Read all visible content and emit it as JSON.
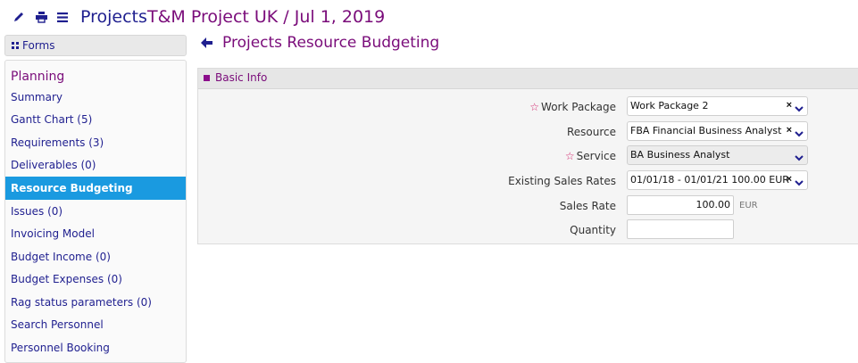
{
  "header": {
    "title_main": "Projects",
    "title_sub": "T&M Project UK / Jul 1, 2019",
    "icons": [
      "pencil-icon",
      "print-icon",
      "menu-icon"
    ]
  },
  "sidebar": {
    "forms_label": "Forms",
    "section_heading": "Planning",
    "items": [
      {
        "label": "Summary",
        "active": false
      },
      {
        "label": "Gantt Chart (5)",
        "active": false
      },
      {
        "label": "Requirements (3)",
        "active": false
      },
      {
        "label": "Deliverables (0)",
        "active": false
      },
      {
        "label": "Resource Budgeting",
        "active": true
      },
      {
        "label": "Issues (0)",
        "active": false
      },
      {
        "label": "Invoicing Model",
        "active": false
      },
      {
        "label": "Budget Income (0)",
        "active": false
      },
      {
        "label": "Budget Expenses (0)",
        "active": false
      },
      {
        "label": "Rag status parameters (0)",
        "active": false
      },
      {
        "label": "Search Personnel",
        "active": false
      },
      {
        "label": "Personnel Booking",
        "active": false
      }
    ]
  },
  "main": {
    "page_title": "Projects Resource Budgeting",
    "section_title": "Basic Info",
    "fields": {
      "work_package": {
        "label": "Work Package",
        "value": "Work Package 2",
        "required": true
      },
      "resource": {
        "label": "Resource",
        "value": "FBA Financial Business Analyst",
        "required": false
      },
      "service": {
        "label": "Service",
        "value": "BA Business Analyst",
        "required": true
      },
      "existing_sales_rates": {
        "label": "Existing Sales Rates",
        "value": "01/01/18 - 01/01/21 100.00 EUR"
      },
      "sales_rate": {
        "label": "Sales Rate",
        "value": "100.00",
        "unit": "EUR"
      },
      "quantity": {
        "label": "Quantity",
        "value": ""
      }
    }
  },
  "colors": {
    "navy": "#1f1f8f",
    "purple": "#7a0c7a",
    "active_blue": "#1a9ae0",
    "required_star": "#d21e6a"
  }
}
